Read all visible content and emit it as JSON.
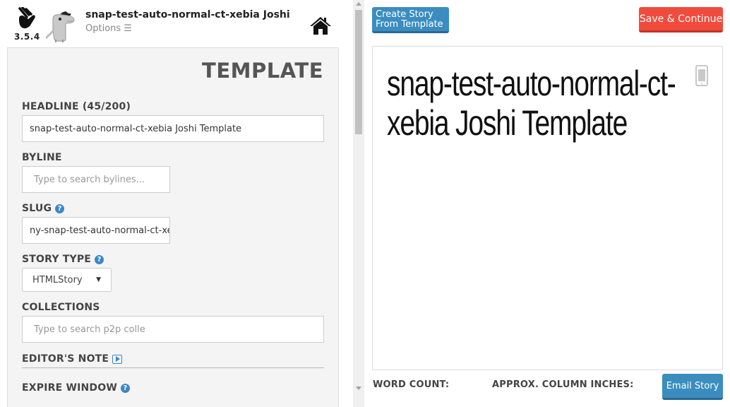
{
  "header": {
    "version": "3.5.4",
    "title": "snap-test-auto-normal-ct-xebia Joshi",
    "options_label": "Options ☰"
  },
  "form": {
    "title": "TEMPLATE",
    "headline_label": "HEADLINE (45/200)",
    "headline_value": "snap-test-auto-normal-ct-xebia Joshi Template",
    "byline_label": "BYLINE",
    "byline_placeholder": "Type to search bylines...",
    "slug_label": "SLUG",
    "slug_value": "ny-snap-test-auto-normal-ct-xe",
    "story_type_label": "STORY TYPE",
    "story_type_value": "HTMLStory",
    "collections_label": "COLLECTIONS",
    "collections_placeholder": "Type to search p2p colle",
    "editors_note_label": "EDITOR'S NOTE",
    "expire_window_label": "EXPIRE WINDOW"
  },
  "toolbar": {
    "create_template_label": "Create Story From Template",
    "save_label": "Save & Continue",
    "email_label": "Email Story"
  },
  "preview": {
    "headline": "snap-test-auto-normal-ct-xebia Joshi Template"
  },
  "stats": {
    "word_count_label": "WORD COUNT:",
    "column_inches_label": "APPROX. COLUMN INCHES:"
  },
  "colors": {
    "accent_blue": "#3b8dbf",
    "save_red": "#f04b3c",
    "help_blue": "#3a87c8"
  }
}
